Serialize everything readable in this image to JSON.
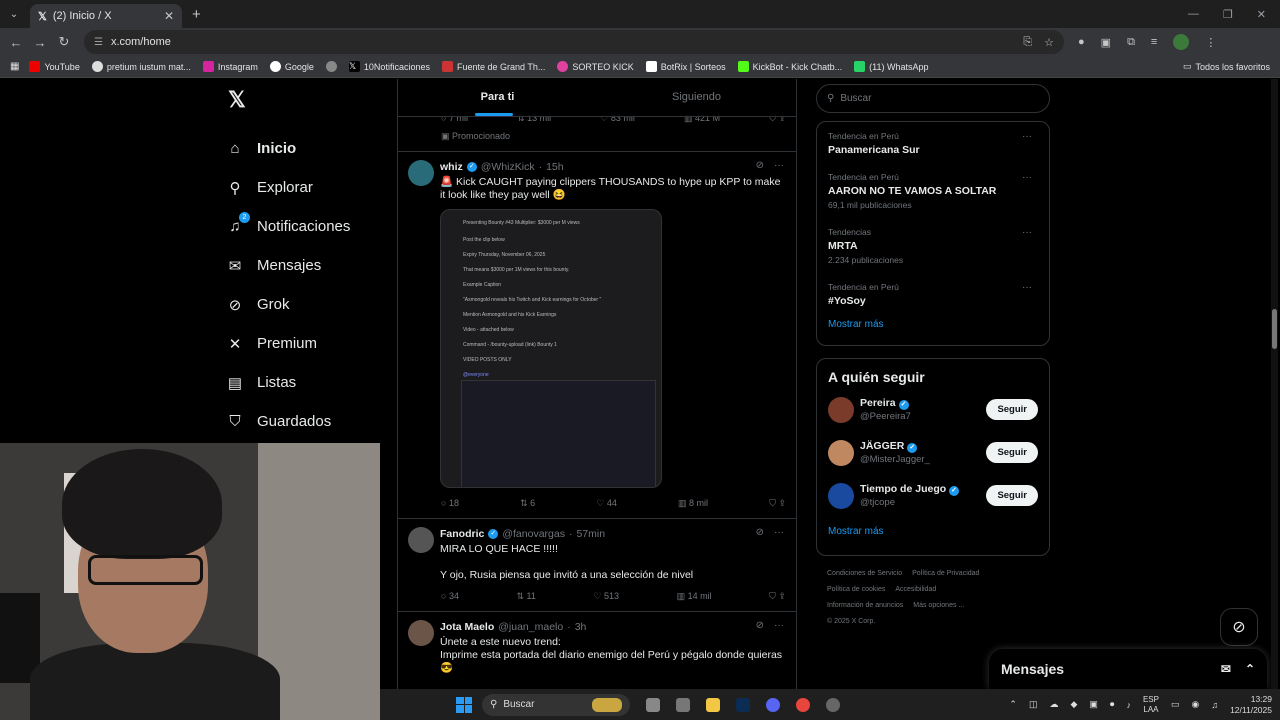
{
  "browser": {
    "tab_title": "(2) Inicio / X",
    "url": "x.com/home",
    "bookmarks": [
      "YouTube",
      "pretium iustum mat...",
      "Instagram",
      "Google",
      "10Notificaciones",
      "Fuente de Grand Th...",
      "SORTEO KICK",
      "BotRix | Sorteos",
      "KickBot - Kick Chatb...",
      "(11) WhatsApp"
    ],
    "bookmarks_all": "Todos los favoritos"
  },
  "nav": {
    "items": [
      {
        "label": "Inicio",
        "icon": "home-icon"
      },
      {
        "label": "Explorar",
        "icon": "search-icon"
      },
      {
        "label": "Notificaciones",
        "icon": "bell-icon",
        "badge": "2"
      },
      {
        "label": "Mensajes",
        "icon": "mail-icon"
      },
      {
        "label": "Grok",
        "icon": "grok-icon"
      },
      {
        "label": "Premium",
        "icon": "x-icon"
      },
      {
        "label": "Listas",
        "icon": "list-icon"
      },
      {
        "label": "Guardados",
        "icon": "bookmark-icon"
      }
    ]
  },
  "feed": {
    "tab_for_you": "Para ti",
    "tab_following": "Siguiendo",
    "promo_stats": {
      "replies": "7 mil",
      "reposts": "13 mil",
      "likes": "83 mil",
      "views": "421 M"
    },
    "promo_label": "Promocionado",
    "posts": [
      {
        "name": "whiz",
        "handle": "@WhizKick",
        "time": "15h",
        "text": "🚨 Kick CAUGHT paying clippers THOUSANDS to hype up KPP to make it look like they pay well 😆",
        "media_lines": [
          "Presenting Bounty #43 Multiplier: $3000 per M views",
          "Post the clip below",
          "Expiry Thursday, November 06, 2025",
          "That means $3000 per 1M views for this bounty.",
          "Example Caption",
          "\"Asmongold reveals his Twitch and Kick earnings for October \"",
          "Mention Asmongold and his Kick Earnings",
          "Video - attached below",
          "Command - /bounty-upload (link) Bounty 1",
          "VIDEO POSTS ONLY",
          "@everyone"
        ],
        "replies": "18",
        "reposts": "6",
        "likes": "44",
        "views": "8 mil"
      },
      {
        "name": "Fanodric",
        "handle": "@fanovargas",
        "time": "57min",
        "text": "MIRA LO QUE HACE !!!!!",
        "text2": "Y ojo, Rusia piensa que invitó a una selección de nivel",
        "replies": "34",
        "reposts": "11",
        "likes": "513",
        "views": "14 mil"
      },
      {
        "name": "Jota Maelo",
        "handle": "@juan_maelo",
        "time": "3h",
        "text": "Únete a este nuevo trend:",
        "text2": "Imprime esta portada del diario enemigo del Perú y pégalo donde quieras",
        "text3": "😎"
      }
    ]
  },
  "sidebar": {
    "search_placeholder": "Buscar",
    "trends": [
      {
        "context": "Tendencia en Perú",
        "title": "Panamericana Sur",
        "count": ""
      },
      {
        "context": "Tendencia en Perú",
        "title": "AARON NO TE VAMOS A SOLTAR",
        "count": "69,1 mil publicaciones"
      },
      {
        "context": "Tendencias",
        "title": "MRTA",
        "count": "2.234 publicaciones"
      },
      {
        "context": "Tendencia en Perú",
        "title": "#YoSoy",
        "count": ""
      }
    ],
    "show_more": "Mostrar más",
    "who_to_follow_title": "A quién seguir",
    "follow": [
      {
        "name": "Pereira",
        "handle": "@Peereira7",
        "btn": "Seguir",
        "color": "#7a3b2a"
      },
      {
        "name": "JÄGGER",
        "handle": "@MisterJagger_",
        "btn": "Seguir",
        "color": "#c08860"
      },
      {
        "name": "Tiempo de Juego",
        "handle": "@tjcope",
        "btn": "Seguir",
        "color": "#1a4aa0"
      }
    ],
    "show_more2": "Mostrar más",
    "footer": [
      "Condiciones de Servicio",
      "Política de Privacidad",
      "Política de cookies",
      "Accesibilidad",
      "Información de anuncios",
      "Más opciones ...",
      "© 2025 X Corp."
    ]
  },
  "messages_drawer": "Mensajes",
  "taskbar": {
    "search": "Buscar",
    "lang1": "ESP",
    "lang2": "LAA",
    "time": "13:29",
    "date": "12/11/2025"
  },
  "colors": {
    "accent": "#1d9bf0",
    "background": "#000000",
    "border": "#2f3336",
    "muted": "#71767b"
  }
}
